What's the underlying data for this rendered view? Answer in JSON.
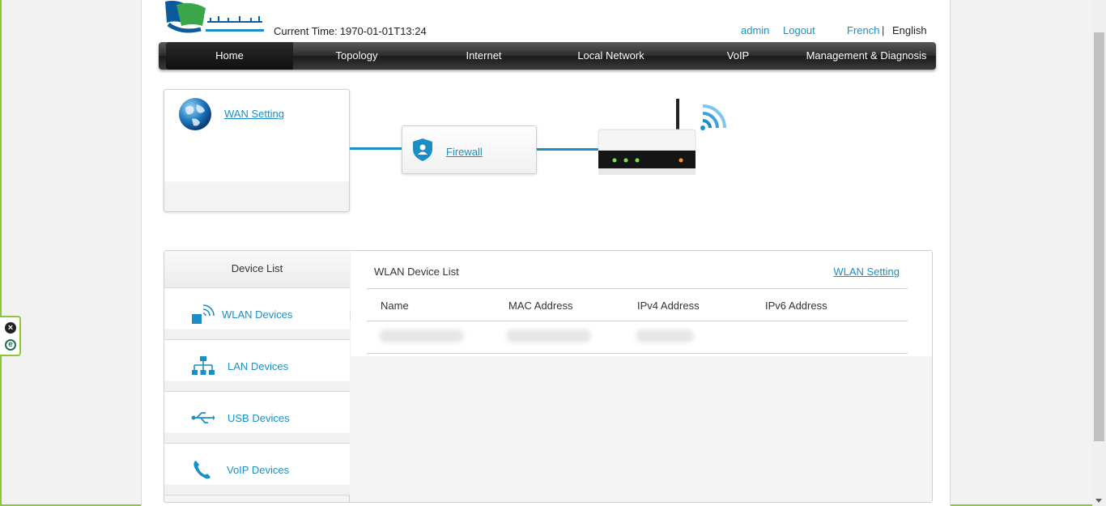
{
  "header": {
    "time_label": "Current Time:",
    "time_value": "1970-01-01T13:24",
    "admin": "admin",
    "logout": "Logout",
    "lang_french": "French",
    "lang_separator": "|",
    "lang_english": "English"
  },
  "nav": {
    "items": [
      "Home",
      "Topology",
      "Internet",
      "Local Network",
      "VoIP",
      "Management & Diagnosis"
    ],
    "active": "Home"
  },
  "topology": {
    "wan_link": "WAN Setting",
    "firewall_link": "Firewall"
  },
  "devices": {
    "title": "Device List",
    "items": [
      "WLAN Devices",
      "LAN Devices",
      "USB Devices",
      "VoIP Devices"
    ],
    "wlan_list_title": "WLAN Device List",
    "wlan_setting_link": "WLAN Setting",
    "columns": [
      "Name",
      "MAC Address",
      "IPv4 Address",
      "IPv6 Address"
    ]
  },
  "colors": {
    "accent": "#1a8fc7",
    "frame": "#8dc63f",
    "nav_dark": "#2b2b2b"
  },
  "icons": {
    "side_tool_1": "close-circle-icon",
    "side_tool_2": "e-circle-icon"
  }
}
